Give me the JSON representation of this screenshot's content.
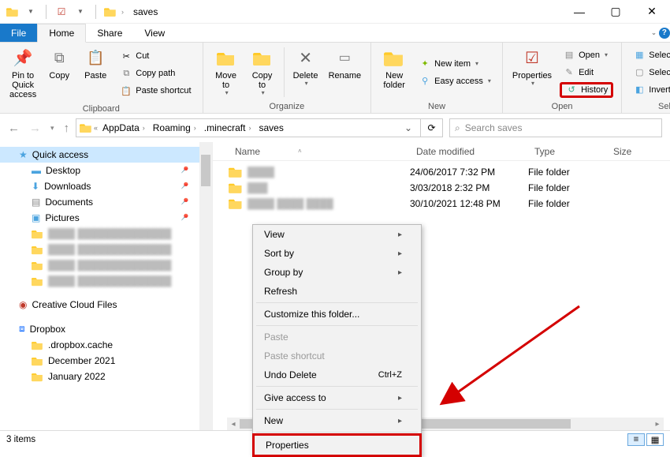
{
  "window": {
    "title": "saves"
  },
  "tabs": {
    "file": "File",
    "home": "Home",
    "share": "Share",
    "view": "View"
  },
  "ribbon": {
    "pin": "Pin to Quick\naccess",
    "copy": "Copy",
    "paste": "Paste",
    "cut": "Cut",
    "copy_path": "Copy path",
    "paste_shortcut": "Paste shortcut",
    "clipboard_group": "Clipboard",
    "move_to": "Move\nto",
    "copy_to": "Copy\nto",
    "delete": "Delete",
    "rename": "Rename",
    "organize_group": "Organize",
    "new_folder": "New\nfolder",
    "new_item": "New item",
    "easy_access": "Easy access",
    "new_group": "New",
    "properties": "Properties",
    "open": "Open",
    "edit": "Edit",
    "history": "History",
    "open_group": "Open",
    "select_all": "Select all",
    "select_none": "Select none",
    "invert_selection": "Invert selection",
    "select_group": "Select"
  },
  "breadcrumbs": [
    "AppData",
    "Roaming",
    ".minecraft",
    "saves"
  ],
  "search": {
    "placeholder": "Search saves"
  },
  "columns": {
    "name": "Name",
    "date": "Date modified",
    "type": "Type",
    "size": "Size"
  },
  "rows": [
    {
      "date": "24/06/2017 7:32 PM",
      "type": "File folder"
    },
    {
      "date": "3/03/2018 2:32 PM",
      "type": "File folder"
    },
    {
      "date": "30/10/2021 12:48 PM",
      "type": "File folder"
    }
  ],
  "sidebar": {
    "quick": "Quick access",
    "desktop": "Desktop",
    "downloads": "Downloads",
    "documents": "Documents",
    "pictures": "Pictures",
    "ccf": "Creative Cloud Files",
    "dropbox": "Dropbox",
    "db_cache": ".dropbox.cache",
    "dec21": "December 2021",
    "jan22": "January 2022"
  },
  "context": {
    "view": "View",
    "sort": "Sort by",
    "group": "Group by",
    "refresh": "Refresh",
    "customize": "Customize this folder...",
    "paste": "Paste",
    "paste_shortcut": "Paste shortcut",
    "undo_delete": "Undo Delete",
    "undo_sc": "Ctrl+Z",
    "give_access": "Give access to",
    "new": "New",
    "properties": "Properties"
  },
  "status": {
    "items": "3 items"
  }
}
